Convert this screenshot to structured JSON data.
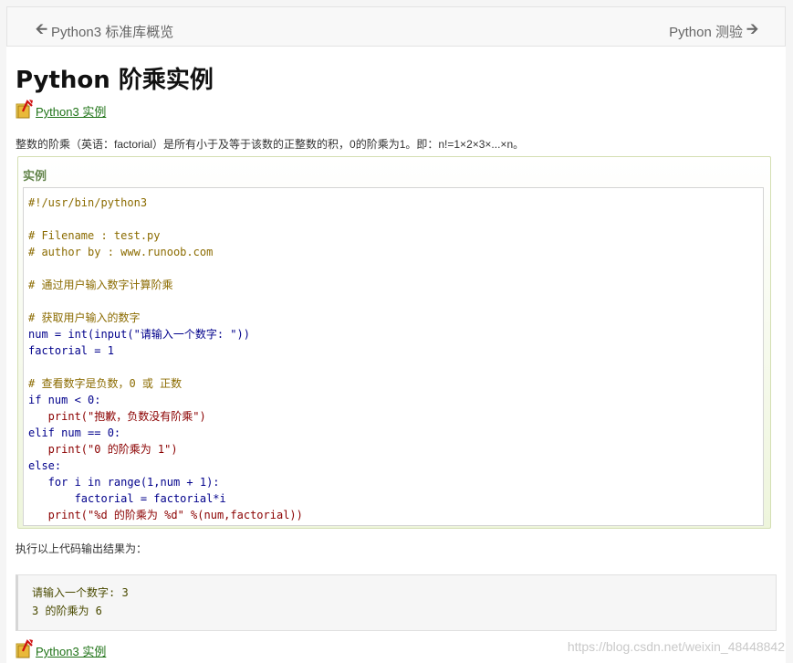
{
  "nav": {
    "prev_label": "Python3 标准库概览",
    "next_label": "Python 测验"
  },
  "page_title": "Python 阶乘实例",
  "example_link_label": "Python3 实例",
  "description": "整数的阶乘（英语：factorial）是所有小于及等于该数的正整数的积，0的阶乘为1。即：n!=1×2×3×...×n。",
  "example": {
    "title": "实例",
    "code_lines": [
      "#!/usr/bin/python3",
      "",
      "# Filename : test.py",
      "# author by : www.runoob.com",
      "",
      "# 通过用户输入数字计算阶乘",
      "",
      "# 获取用户输入的数字",
      "num = int(input(\"请输入一个数字: \"))",
      "factorial = 1",
      "",
      "# 查看数字是负数，0 或 正数",
      "if num < 0:",
      "   print(\"抱歉，负数没有阶乘\")",
      "elif num == 0:",
      "   print(\"0 的阶乘为 1\")",
      "else:",
      "   for i in range(1,num + 1):",
      "       factorial = factorial*i",
      "   print(\"%d 的阶乘为 %d\" %(num,factorial))"
    ]
  },
  "exec_label": "执行以上代码输出结果为：",
  "output_lines": [
    "请输入一个数字: 3",
    "3 的阶乘为 6"
  ],
  "bottom_link_label": "Python3 实例",
  "watermark": "https://blog.csdn.net/weixin_48448842",
  "colors": {
    "link": "#1f7317",
    "example_title": "#64854c",
    "example_border": "#d4dfb3"
  }
}
